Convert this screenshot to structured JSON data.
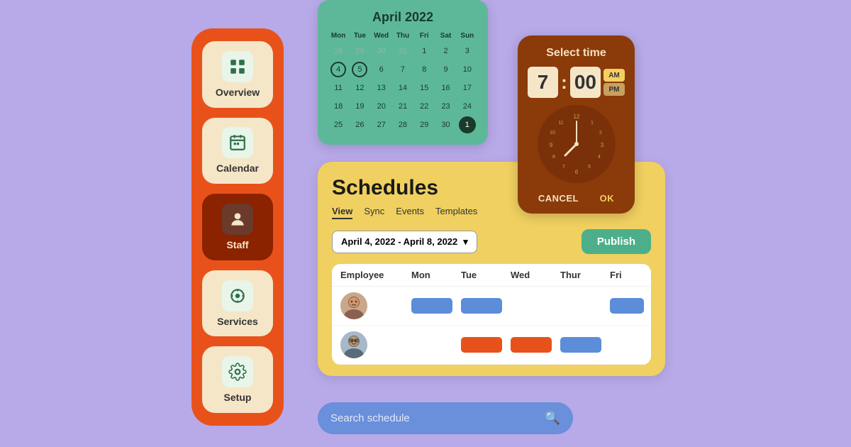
{
  "background_color": "#b8a9e8",
  "sidebar": {
    "items": [
      {
        "id": "overview",
        "label": "Overview",
        "active": false
      },
      {
        "id": "calendar",
        "label": "Calendar",
        "active": false
      },
      {
        "id": "staff",
        "label": "Staff",
        "active": true
      },
      {
        "id": "services",
        "label": "Services",
        "active": false
      },
      {
        "id": "setup",
        "label": "Setup",
        "active": false
      }
    ]
  },
  "calendar": {
    "title": "April 2022",
    "days": [
      "Mon",
      "Tue",
      "Wed",
      "Thu",
      "Fri",
      "Sat",
      "Sun"
    ],
    "weeks": [
      [
        "28",
        "29",
        "30",
        "31",
        "1",
        "2",
        "3"
      ],
      [
        "4",
        "5",
        "6",
        "7",
        "8",
        "9",
        "10"
      ],
      [
        "11",
        "12",
        "13",
        "14",
        "15",
        "16",
        "17"
      ],
      [
        "18",
        "19",
        "20",
        "21",
        "22",
        "23",
        "24"
      ],
      [
        "25",
        "26",
        "27",
        "28",
        "29",
        "30",
        "1"
      ]
    ],
    "prev_month_cells": [
      "28",
      "29",
      "30",
      "31"
    ],
    "next_month_cells": [
      "1"
    ],
    "circled": [
      "4",
      "5"
    ],
    "highlighted_end": "1"
  },
  "time_picker": {
    "title": "Select time",
    "hour": "7",
    "minutes": "00",
    "am": "AM",
    "pm": "PM",
    "active_period": "AM",
    "cancel_label": "CANCEL",
    "ok_label": "OK"
  },
  "schedules": {
    "title": "Schedules",
    "tabs": [
      {
        "label": "View",
        "active": true
      },
      {
        "label": "Sync",
        "active": false
      },
      {
        "label": "Events",
        "active": false
      },
      {
        "label": "Templates",
        "active": false
      }
    ],
    "date_range": "April 4, 2022 - April 8, 2022",
    "publish_label": "Publish",
    "table": {
      "headers": [
        "Employee",
        "Mon",
        "Tue",
        "Wed",
        "Thur",
        "Fri"
      ],
      "rows": [
        {
          "employee_id": "emp1",
          "shifts": {
            "Mon": "blue",
            "Tue": "blue",
            "Wed": null,
            "Thur": null,
            "Fri": "blue"
          }
        },
        {
          "employee_id": "emp2",
          "shifts": {
            "Mon": null,
            "Tue": "orange",
            "Wed": "orange",
            "Thur": "blue",
            "Fri": null
          }
        }
      ]
    }
  },
  "search": {
    "placeholder": "Search schedule"
  }
}
